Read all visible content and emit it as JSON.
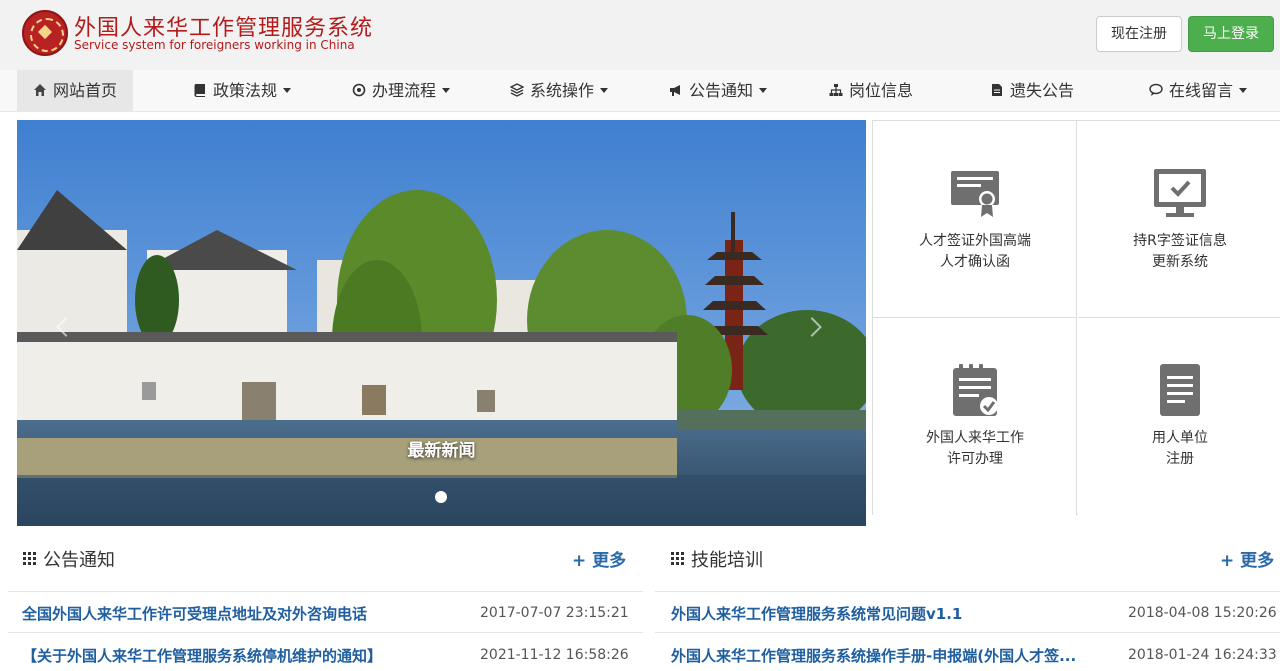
{
  "header": {
    "title": "外国人来华工作管理服务系统",
    "subtitle": "Service system for foreigners working in China",
    "register_label": "现在注册",
    "login_label": "马上登录"
  },
  "nav": {
    "items": [
      {
        "label": "网站首页",
        "icon": "home-icon",
        "dropdown": false
      },
      {
        "label": "政策法规",
        "icon": "book-icon",
        "dropdown": true
      },
      {
        "label": "办理流程",
        "icon": "target-icon",
        "dropdown": true
      },
      {
        "label": "系统操作",
        "icon": "layers-icon",
        "dropdown": true
      },
      {
        "label": "公告通知",
        "icon": "bullhorn-icon",
        "dropdown": true
      },
      {
        "label": "岗位信息",
        "icon": "sitemap-icon",
        "dropdown": false
      },
      {
        "label": "遗失公告",
        "icon": "file-icon",
        "dropdown": false
      },
      {
        "label": "在线留言",
        "icon": "comment-icon",
        "dropdown": true
      }
    ]
  },
  "carousel": {
    "caption": "最新新闻"
  },
  "services": [
    {
      "line1": "人才签证外国高端",
      "line2": "人才确认函",
      "icon": "certificate-icon"
    },
    {
      "line1": "持R字签证信息",
      "line2": "更新系统",
      "icon": "monitor-check-icon"
    },
    {
      "line1": "外国人来华工作",
      "line2": "许可办理",
      "icon": "clipboard-check-icon"
    },
    {
      "line1": "用人单位",
      "line2": "注册",
      "icon": "document-icon"
    }
  ],
  "notices": {
    "title": "公告通知",
    "more": "+ 更多",
    "items": [
      {
        "title": "全国外国人来华工作许可受理点地址及对外咨询电话",
        "date": "2017-07-07 23:15:21"
      },
      {
        "title": "【关于外国人来华工作管理服务系统停机维护的通知】",
        "date": "2021-11-12 16:58:26"
      }
    ]
  },
  "training": {
    "title": "技能培训",
    "more": "+ 更多",
    "items": [
      {
        "title": "外国人来华工作管理服务系统常见问题v1.1",
        "date": "2018-04-08 15:20:26"
      },
      {
        "title": "外国人来华工作管理服务系统操作手册-申报端(外国人才签...",
        "date": "2018-01-24 16:24:33"
      }
    ]
  },
  "colors": {
    "brand_red": "#b31b1b",
    "login_green": "#4cae4c",
    "link_blue": "#1f5fa0",
    "icon_gray": "#6f6f6f"
  }
}
